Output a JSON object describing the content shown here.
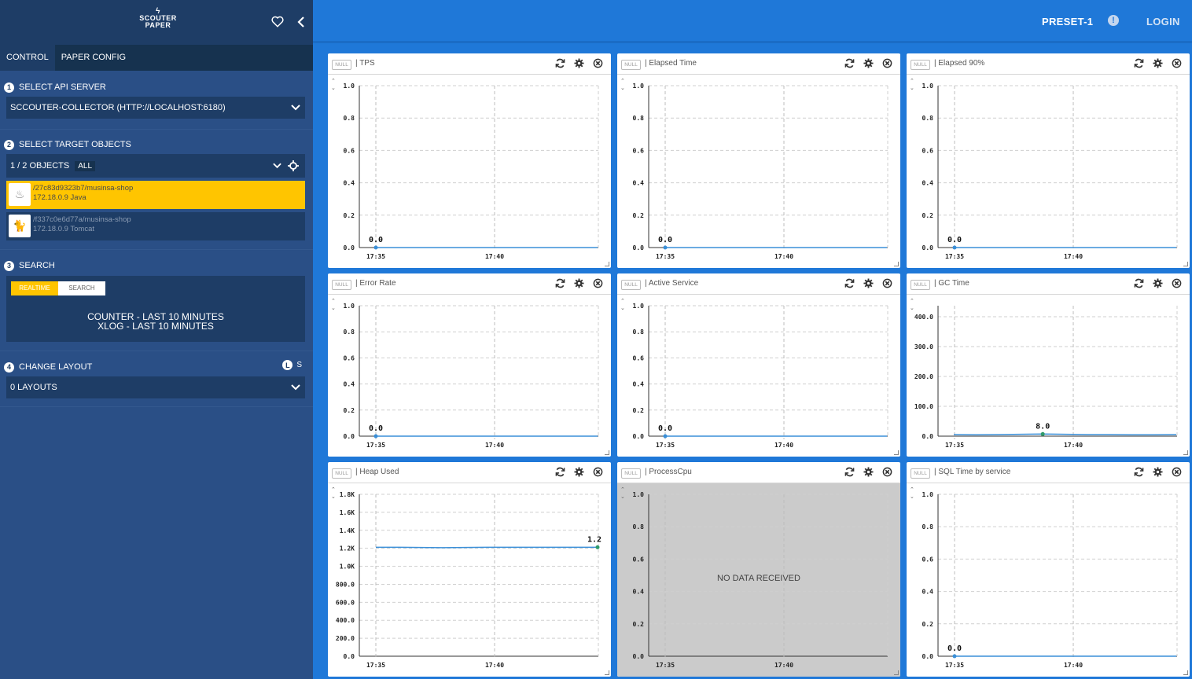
{
  "sidebar": {
    "logo_line1": "SCOUTER",
    "logo_line2": "PAPER",
    "tabs": [
      {
        "label": "CONTROL"
      },
      {
        "label": "PAPER CONFIG"
      }
    ],
    "sections": {
      "api": {
        "num": "1",
        "title": "SELECT API SERVER",
        "value": "SCCOUTER-COLLECTOR (HTTP://LOCALHOST:6180)"
      },
      "target": {
        "num": "2",
        "title": "SELECT TARGET OBJECTS",
        "count": "1 / 2 OBJECTS",
        "all": "ALL"
      },
      "objects": [
        {
          "path": "/27c83d9323b7/musinsa-shop",
          "meta": "172.18.0.9  Java",
          "selected": true
        },
        {
          "path": "/f337c0e6d77a/musinsa-shop",
          "meta": "172.18.0.9  Tomcat",
          "selected": false
        }
      ],
      "search": {
        "num": "3",
        "title": "SEARCH",
        "toggle_on": "REALTIME",
        "toggle_off": "SEARCH",
        "line1": "COUNTER - LAST 10 MINUTES",
        "line2": "XLOG - LAST 10 MINUTES"
      },
      "layout": {
        "num": "4",
        "title": "CHANGE LAYOUT",
        "l": "L",
        "s": "S",
        "value": "0 LAYOUTS"
      }
    }
  },
  "topbar": {
    "preset": "PRESET-1",
    "info": "!",
    "login": "LOGIN"
  },
  "panels": [
    {
      "badge": "NULL",
      "title": "| TPS",
      "yticks": [
        "1.0",
        "0.8",
        "0.6",
        "0.4",
        "0.2",
        "0.0"
      ],
      "xticks": [
        "17:35",
        "17:40"
      ],
      "value_label": "0.0",
      "series": {
        "y": [
          0,
          0,
          0,
          0,
          0,
          0,
          0,
          0,
          0,
          0,
          0
        ]
      },
      "ymax": 1.0,
      "point_at": 0
    },
    {
      "badge": "NULL",
      "title": "| Elapsed Time",
      "yticks": [
        "1.0",
        "0.8",
        "0.6",
        "0.4",
        "0.2",
        "0.0"
      ],
      "xticks": [
        "17:35",
        "17:40"
      ],
      "value_label": "0.0",
      "series": {
        "y": [
          0,
          0,
          0,
          0,
          0,
          0,
          0,
          0,
          0,
          0,
          0
        ]
      },
      "ymax": 1.0,
      "point_at": 0
    },
    {
      "badge": "NULL",
      "title": "| Elapsed 90%",
      "yticks": [
        "1.0",
        "0.8",
        "0.6",
        "0.4",
        "0.2",
        "0.0"
      ],
      "xticks": [
        "17:35",
        "17:40"
      ],
      "value_label": "0.0",
      "series": {
        "y": [
          0,
          0,
          0,
          0,
          0,
          0,
          0,
          0,
          0,
          0,
          0
        ]
      },
      "ymax": 1.0,
      "point_at": 0
    },
    {
      "badge": "NULL",
      "title": "| Error Rate",
      "yticks": [
        "1.0",
        "0.8",
        "0.6",
        "0.4",
        "0.2",
        "0.0"
      ],
      "xticks": [
        "17:35",
        "17:40"
      ],
      "value_label": "0.0",
      "series": {
        "y": [
          0,
          0,
          0,
          0,
          0,
          0,
          0,
          0,
          0,
          0,
          0
        ]
      },
      "ymax": 1.0,
      "point_at": 0
    },
    {
      "badge": "NULL",
      "title": "| Active Service",
      "yticks": [
        "1.0",
        "0.8",
        "0.6",
        "0.4",
        "0.2",
        "0.0"
      ],
      "xticks": [
        "17:35",
        "17:40"
      ],
      "value_label": "0.0",
      "series": {
        "y": [
          0,
          0,
          0,
          0,
          0,
          0,
          0,
          0,
          0,
          0,
          0
        ]
      },
      "ymax": 1.0,
      "point_at": 0
    },
    {
      "badge": "NULL",
      "title": "| GC Time",
      "yticks": [
        "400.0",
        "300.0",
        "200.0",
        "100.0",
        "0.0"
      ],
      "xticks": [
        "17:35",
        "17:40"
      ],
      "value_label": "8.0",
      "series": {
        "y": [
          6,
          5,
          6,
          7,
          8,
          7,
          6,
          6,
          5,
          5,
          6
        ]
      },
      "ymax": 450,
      "point_at": 4
    },
    {
      "badge": "NULL",
      "title": "| Heap Used",
      "yticks": [
        "1.8K",
        "1.6K",
        "1.4K",
        "1.2K",
        "1.0K",
        "800.0",
        "600.0",
        "400.0",
        "200.0",
        "0.0"
      ],
      "xticks": [
        "17:35",
        "17:40"
      ],
      "value_label": "1.2",
      "series": {
        "y": [
          1225,
          1225,
          1222,
          1220,
          1222,
          1225,
          1225,
          1225,
          1225,
          1225,
          1225
        ]
      },
      "ymax": 1820,
      "point_at": 10
    },
    {
      "badge": "NULL",
      "title": "| ProcessCpu",
      "yticks": [
        "1.0",
        "0.8",
        "0.6",
        "0.4",
        "0.2",
        "0.0"
      ],
      "xticks": [
        "17:35",
        "17:40"
      ],
      "no_data": "NO DATA RECEIVED"
    },
    {
      "badge": "NULL",
      "title": "| SQL Time by service",
      "yticks": [
        "1.0",
        "0.8",
        "0.6",
        "0.4",
        "0.2",
        "0.0"
      ],
      "xticks": [
        "17:35",
        "17:40"
      ],
      "value_label": "0.0",
      "series": {
        "y": [
          0,
          0,
          0,
          0,
          0,
          0,
          0,
          0,
          0,
          0,
          0
        ]
      },
      "ymax": 1.0,
      "point_at": 0
    }
  ],
  "colors": {
    "accent": "#1f78d8",
    "selected": "#ffc500",
    "line": "#3a8fd8",
    "point": "#2e9a6a"
  }
}
